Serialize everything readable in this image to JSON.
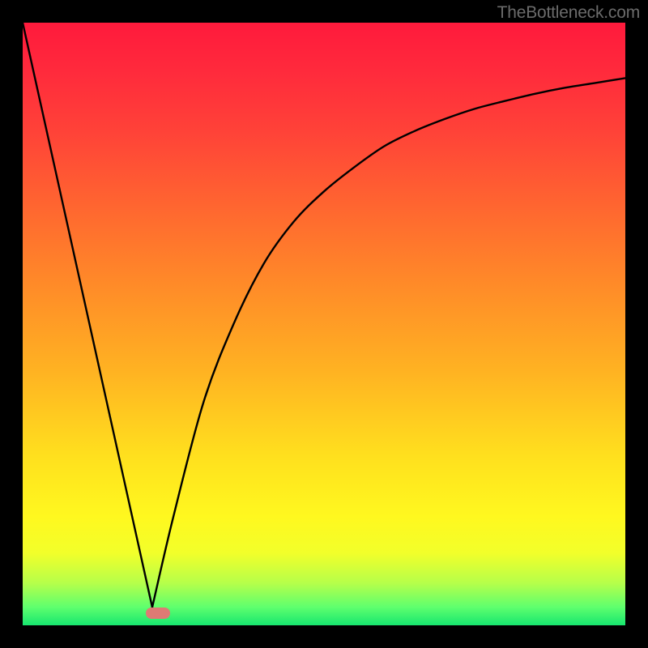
{
  "watermark": "TheBottleneck.com",
  "chart_data": {
    "type": "line",
    "title": "",
    "xlabel": "",
    "ylabel": "",
    "xlim": [
      0,
      100
    ],
    "ylim": [
      0,
      100
    ],
    "series": [
      {
        "name": "left-line",
        "x": [
          0,
          21.5
        ],
        "values": [
          100,
          3
        ]
      },
      {
        "name": "right-curve",
        "x": [
          21.5,
          25,
          30,
          35,
          40,
          45,
          50,
          55,
          60,
          65,
          70,
          75,
          80,
          85,
          90,
          95,
          100
        ],
        "values": [
          3,
          18,
          37,
          50,
          60,
          67,
          72,
          76,
          79.5,
          82,
          84,
          85.7,
          87,
          88.2,
          89.2,
          90,
          90.8
        ]
      }
    ],
    "marker": {
      "x": 22.5,
      "y": 2.0
    },
    "notes": "Background is a vertical red→yellow→green gradient framed by black borders; V-shaped black curve with minimum near x≈22."
  }
}
